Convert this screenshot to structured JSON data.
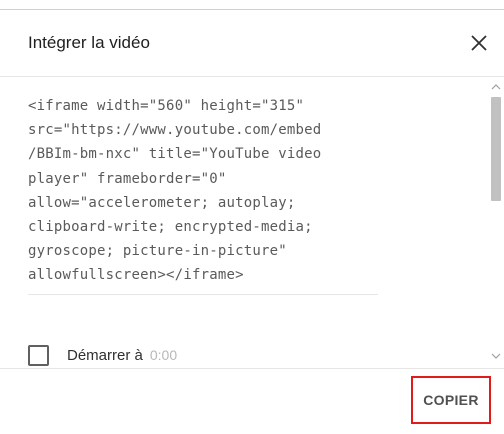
{
  "dialog": {
    "title": "Intégrer la vidéo",
    "close_icon": "close-icon"
  },
  "embed_code": {
    "lines": [
      "<iframe width=\"560\" height=\"315\"",
      "src=\"https://www.youtube.com/embed",
      "/BBIm-bm-nxc\" title=\"YouTube video",
      "player\" frameborder=\"0\"",
      "allow=\"accelerometer; autoplay;",
      "clipboard-write; encrypted-media;",
      "gyroscope; picture-in-picture\"",
      "allowfullscreen></iframe>"
    ]
  },
  "start_at": {
    "label": "Démarrer à",
    "time": "0:00",
    "checked": false
  },
  "footer": {
    "copy_label": "COPIER",
    "highlight_color": "#e01b1b"
  }
}
